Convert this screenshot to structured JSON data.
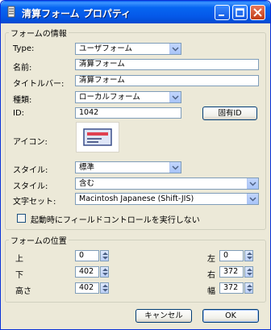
{
  "window": {
    "title": "清算フォーム プロパティ"
  },
  "form_info": {
    "legend": "フォームの情報",
    "type": {
      "label": "Type:",
      "value": "ユーザフォーム"
    },
    "name": {
      "label": "名前:",
      "value": "清算フォーム"
    },
    "titlebar": {
      "label": "タイトルバー:",
      "value": "清算フォーム"
    },
    "kind": {
      "label": "種類:",
      "value": "ローカルフォーム"
    },
    "id": {
      "label": "ID:",
      "value": "1042",
      "button": "固有ID"
    },
    "icon": {
      "label": "アイコン:"
    },
    "style1": {
      "label": "スタイル:",
      "value": "標準"
    },
    "style2": {
      "label": "スタイル:",
      "value": "含む"
    },
    "charset": {
      "label": "文字セット:",
      "value": "Macintosh Japanese (Shift-JIS)"
    },
    "checkbox": {
      "label": "起動時にフィールドコントロールを実行しない",
      "checked": false
    }
  },
  "form_position": {
    "legend": "フォームの位置",
    "top": {
      "label": "上",
      "value": "0"
    },
    "bottom": {
      "label": "下",
      "value": "402"
    },
    "height": {
      "label": "高さ",
      "value": "402"
    },
    "left": {
      "label": "左",
      "value": "0"
    },
    "right": {
      "label": "右",
      "value": "372"
    },
    "width": {
      "label": "幅",
      "value": "372"
    }
  },
  "buttons": {
    "cancel": "キャンセル",
    "ok": "OK"
  },
  "colors": {
    "titlebar": "#0558e8",
    "dialog_bg": "#ece9d8",
    "field_border": "#7f9db9"
  }
}
